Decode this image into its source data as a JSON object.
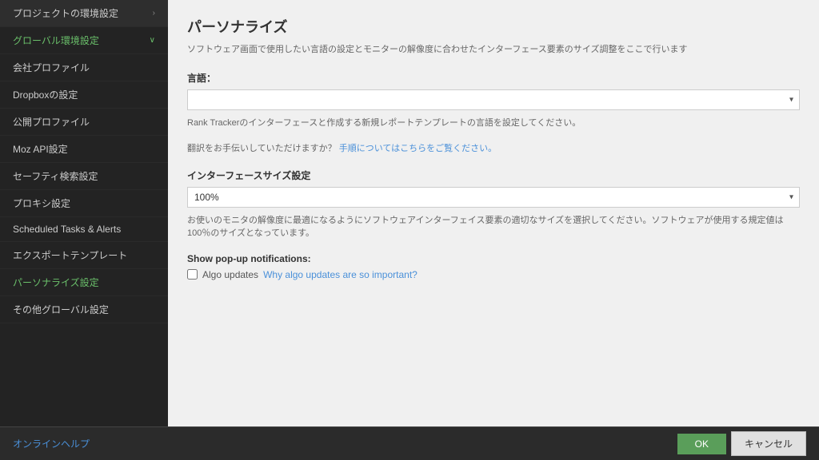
{
  "sidebar": {
    "items": [
      {
        "id": "project-env",
        "label": "プロジェクトの環境設定",
        "hasChevron": true,
        "active": false
      },
      {
        "id": "global-env",
        "label": "グローバル環境設定",
        "hasChevron": true,
        "active": true,
        "green": true
      },
      {
        "id": "company-profile",
        "label": "会社プロファイル",
        "hasChevron": false,
        "active": false
      },
      {
        "id": "dropbox",
        "label": "Dropboxの設定",
        "hasChevron": false,
        "active": false
      },
      {
        "id": "public-profile",
        "label": "公開プロファイル",
        "hasChevron": false,
        "active": false
      },
      {
        "id": "moz-api",
        "label": "Moz API設定",
        "hasChevron": false,
        "active": false
      },
      {
        "id": "safety-search",
        "label": "セーフティ検索設定",
        "hasChevron": false,
        "active": false
      },
      {
        "id": "proxy",
        "label": "プロキシ設定",
        "hasChevron": false,
        "active": false
      },
      {
        "id": "scheduled",
        "label": "Scheduled Tasks & Alerts",
        "hasChevron": false,
        "active": false
      },
      {
        "id": "export-template",
        "label": "エクスポートテンプレート",
        "hasChevron": false,
        "active": false
      },
      {
        "id": "personalize",
        "label": "パーソナライズ設定",
        "hasChevron": false,
        "active": false,
        "green": true
      },
      {
        "id": "other-global",
        "label": "その他グローバル設定",
        "hasChevron": false,
        "active": false
      }
    ]
  },
  "main": {
    "title": "パーソナライズ",
    "description": "ソフトウェア画面で使用したい言語の設定とモニターの解像度に合わせたインターフェース要素のサイズ調整をここで行います",
    "language_label": "言語：",
    "language_placeholder": "",
    "language_helper": "Rank Trackerのインターフェースと作成する新規レポートテンプレートの言語を設定してください。",
    "translation_prompt": "翻訳をお手伝いしていただけますか？",
    "translation_link": "手順についてはこちらをご覧ください。",
    "interface_size_title": "インターフェースサイズ設定",
    "interface_size_value": "100%",
    "interface_size_helper": "お使いのモニタの解像度に最適になるようにソフトウェアインターフェイス要素の適切なサイズを選択してください。ソフトウェアが使用する規定値は100％のサイズとなっています。",
    "popup_label": "Show pop-up notifications:",
    "algo_updates_label": "Algo updates",
    "algo_updates_link": "Why algo updates are so important?"
  },
  "footer": {
    "online_help": "オンラインヘルプ",
    "ok_button": "OK",
    "cancel_button": "キャンセル"
  }
}
